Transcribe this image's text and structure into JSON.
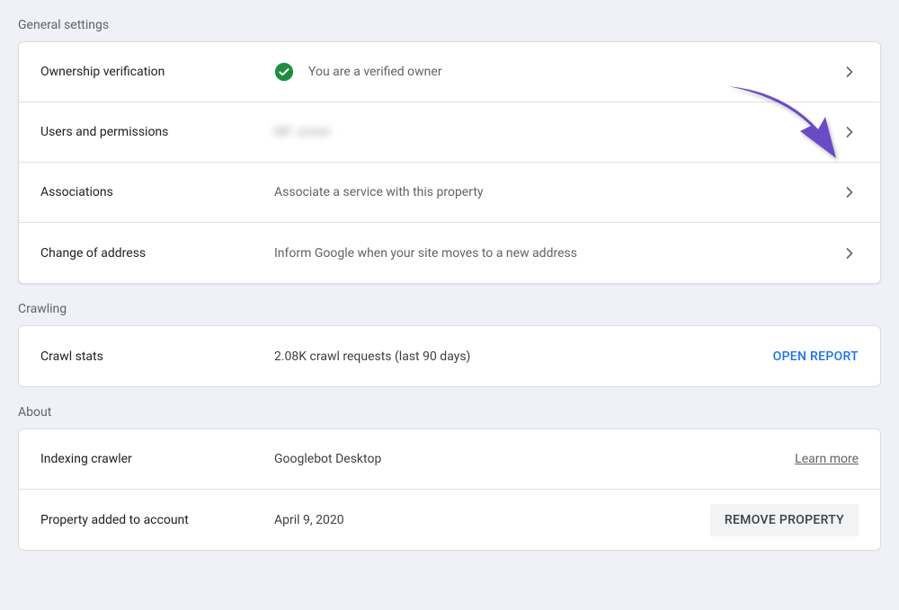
{
  "sections": {
    "general": {
      "title": "General settings",
      "rows": {
        "ownership": {
          "label": "Ownership verification",
          "value": "You are a verified owner"
        },
        "users": {
          "label": "Users and permissions",
          "value": "MF Junior"
        },
        "associations": {
          "label": "Associations",
          "value": "Associate a service with this property"
        },
        "change": {
          "label": "Change of address",
          "value": "Inform Google when your site moves to a new address"
        }
      }
    },
    "crawling": {
      "title": "Crawling",
      "rows": {
        "stats": {
          "label": "Crawl stats",
          "value": "2.08K crawl requests (last 90 days)",
          "action": "OPEN REPORT"
        }
      }
    },
    "about": {
      "title": "About",
      "rows": {
        "crawler": {
          "label": "Indexing crawler",
          "value": "Googlebot Desktop",
          "link": "Learn more"
        },
        "added": {
          "label": "Property added to account",
          "value": "April 9, 2020",
          "button": "REMOVE PROPERTY"
        }
      }
    }
  }
}
